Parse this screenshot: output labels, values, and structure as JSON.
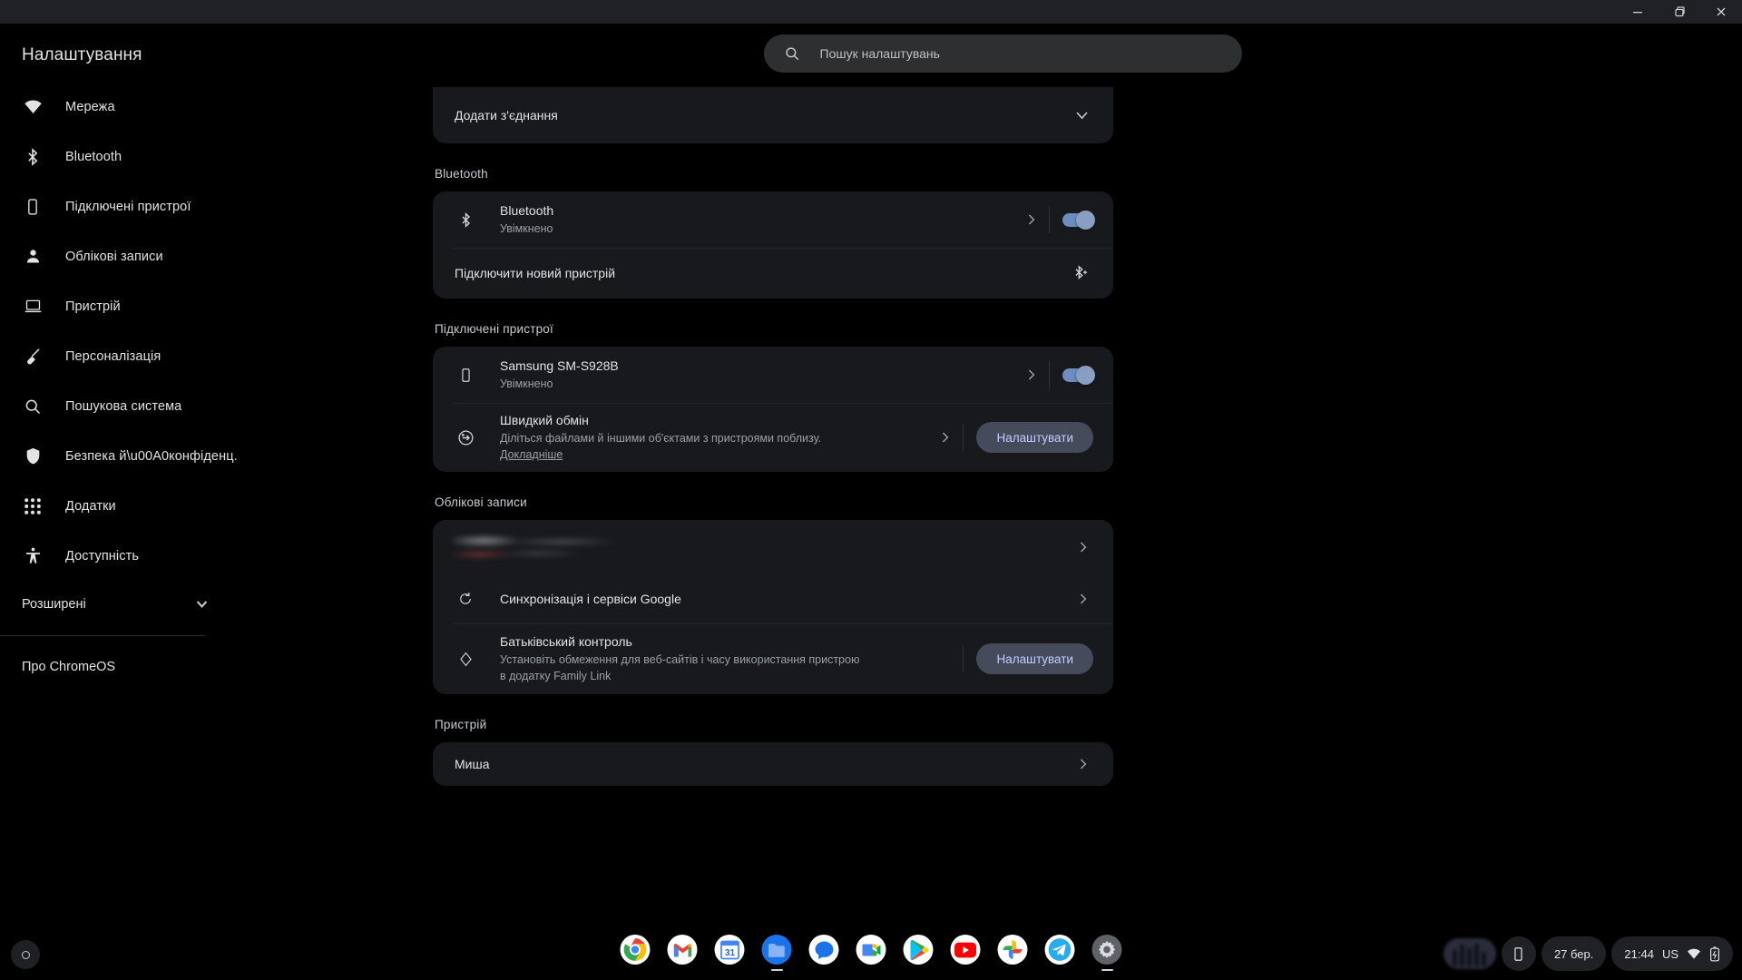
{
  "window": {
    "minimize_label": "minimize",
    "maximize_label": "maximize",
    "close_label": "close"
  },
  "sidebar": {
    "title": "Налаштування",
    "items": [
      {
        "label": "Мережа",
        "icon": "wifi-icon"
      },
      {
        "label": "Bluetooth",
        "icon": "bluetooth-icon"
      },
      {
        "label": "Підключені пристрої",
        "icon": "phone-icon"
      },
      {
        "label": "Облікові записи",
        "icon": "person-icon"
      },
      {
        "label": "Пристрій",
        "icon": "laptop-icon"
      },
      {
        "label": "Персоналізація",
        "icon": "brush-icon"
      },
      {
        "label": "Пошукова система",
        "icon": "search-icon"
      },
      {
        "label": "Безпека й\\u00A0конфіденц.",
        "icon": "shield-icon"
      },
      {
        "label": "Додатки",
        "icon": "grid-apps-icon"
      },
      {
        "label": "Доступність",
        "icon": "accessibility-icon"
      }
    ],
    "advanced": {
      "label": "Розширені",
      "icon": "chevron-down-icon"
    },
    "about": {
      "label": "Про ChromeOS"
    }
  },
  "search": {
    "placeholder": "Пошук налаштувань",
    "value": "",
    "icon": "search-icon"
  },
  "main": {
    "network_card": {
      "add_connection": {
        "label": "Додати з'єднання",
        "icon": "chevron-down-icon"
      }
    },
    "bluetooth": {
      "section_title": "Bluetooth",
      "rows": [
        {
          "title": "Bluetooth",
          "subtitle": "Увімкнено",
          "icon": "bluetooth-icon",
          "toggle": "on",
          "chevron": "chevron-right-icon"
        },
        {
          "title": "Підключити новий пристрій",
          "icon": "bluetooth-search-icon"
        }
      ]
    },
    "connected_devices": {
      "section_title": "Підключені пристрої",
      "device": {
        "title": "Samsung SM-S928B",
        "subtitle": "Увімкнено",
        "icon": "phone-icon",
        "toggle": "on",
        "chevron": "chevron-right-icon"
      },
      "quick_share": {
        "title": "Швидкий обмін",
        "subtitle": "Діліться файлами й іншими об'єктами з пристроями поблизу.",
        "link": "Докладніше",
        "icon": "quick-share-icon",
        "chevron": "chevron-right-icon",
        "button": "Налаштувати"
      }
    },
    "accounts": {
      "section_title": "Облікові записи",
      "account_row": {
        "chevron": "chevron-right-icon"
      },
      "sync": {
        "title": "Синхронізація і сервіси Google",
        "icon": "sync-icon",
        "chevron": "chevron-right-icon"
      },
      "parental": {
        "title": "Батьківський контроль",
        "subtitle": "Установіть обмеження для веб-сайтів і часу використання пристрою в додатку Family Link",
        "icon": "family-link-icon",
        "button": "Налаштувати"
      }
    },
    "device": {
      "section_title": "Пристрій",
      "rows": [
        {
          "title": "Миша",
          "chevron": "chevron-right-icon"
        }
      ]
    }
  },
  "shelf": {
    "launcher": "launcher-icon",
    "apps": [
      {
        "name": "chrome-icon",
        "running": false
      },
      {
        "name": "gmail-icon",
        "running": false
      },
      {
        "name": "calendar-icon",
        "running": false
      },
      {
        "name": "files-icon",
        "running": true
      },
      {
        "name": "messages-icon",
        "running": false
      },
      {
        "name": "meet-icon",
        "running": false
      },
      {
        "name": "play-store-icon",
        "running": false
      },
      {
        "name": "youtube-icon",
        "running": false
      },
      {
        "name": "photos-icon",
        "running": false
      },
      {
        "name": "telegram-icon",
        "running": false
      },
      {
        "name": "settings-icon",
        "running": true
      }
    ],
    "status": {
      "date": "27 бер.",
      "time": "21:44",
      "keyboard": "US",
      "wifi_icon": "wifi-icon",
      "battery_icon": "battery-charging-icon",
      "phone_hub_icon": "phone-icon",
      "screen_capture_icon": "video-thumbnail"
    }
  },
  "colors": {
    "accent": "#8ab4f8",
    "button_bg": "#464b5c",
    "button_text": "#c3cbff",
    "card_bg": "#18191c",
    "page_bg": "#000000"
  }
}
